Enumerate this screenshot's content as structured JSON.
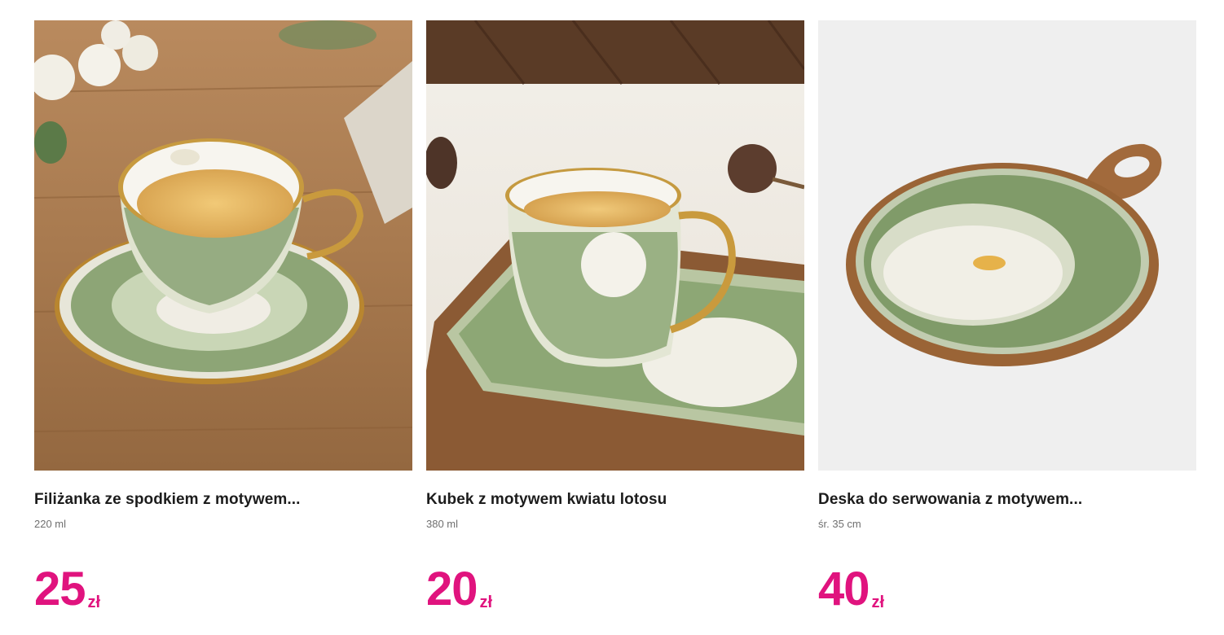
{
  "products": [
    {
      "name": "Filiżanka ze spodkiem z motywem...",
      "detail": "220 ml",
      "price": "25",
      "currency": "zł",
      "image": "teacup-with-saucer-photo"
    },
    {
      "name": "Kubek z motywem kwiatu lotosu",
      "detail": "380 ml",
      "price": "20",
      "currency": "zł",
      "image": "mug-on-tray-photo"
    },
    {
      "name": "Deska do serwowania z motywem...",
      "detail": "śr. 35 cm",
      "price": "40",
      "currency": "zł",
      "image": "serving-board-photo"
    }
  ],
  "colors": {
    "price": "#e0137e",
    "title": "#1c1c1c",
    "detail": "#6f6f6f"
  }
}
